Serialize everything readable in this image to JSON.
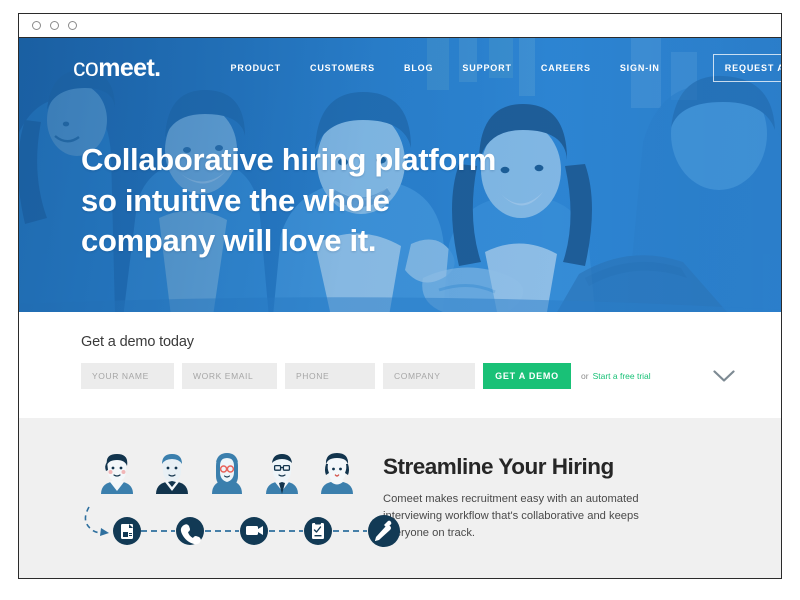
{
  "browser": {
    "dots": [
      "traffic-dot",
      "traffic-dot",
      "traffic-dot"
    ]
  },
  "hero": {
    "logo_light": "co",
    "logo_bold": "meet.",
    "nav": [
      {
        "label": "PRODUCT"
      },
      {
        "label": "CUSTOMERS"
      },
      {
        "label": "BLOG"
      },
      {
        "label": "SUPPORT"
      },
      {
        "label": "CAREERS"
      },
      {
        "label": "SIGN-IN"
      }
    ],
    "cta_label": "REQUEST A DEMO ›",
    "headline_line1": "Collaborative hiring platform",
    "headline_line2": "so intuitive the whole",
    "headline_line3": "company will love it.",
    "bg_left": "#1d66ad",
    "bg_right": "#2f85d3"
  },
  "demo_form": {
    "heading": "Get a demo today",
    "fields": [
      {
        "placeholder": "YOUR NAME",
        "value": ""
      },
      {
        "placeholder": "WORK EMAIL",
        "value": ""
      },
      {
        "placeholder": "PHONE",
        "value": ""
      },
      {
        "placeholder": "COMPANY",
        "value": ""
      }
    ],
    "submit_label": "GET A DEMO",
    "or_text": "or",
    "trial_link": "Start a free trial",
    "accent_green": "#19c177",
    "expand_icon": "chevron-down-icon"
  },
  "streamline": {
    "title": "Streamline Your Hiring",
    "body": "Comeet makes recruitment easy with an automated interviewing workflow that's collaborative and keeps everyone on track.",
    "avatars": [
      {
        "name": "avatar-person-1"
      },
      {
        "name": "avatar-person-2"
      },
      {
        "name": "avatar-person-3"
      },
      {
        "name": "avatar-person-4"
      },
      {
        "name": "avatar-person-5"
      }
    ],
    "steps": [
      {
        "icon": "resume-icon"
      },
      {
        "icon": "phone-icon"
      },
      {
        "icon": "video-interview-icon"
      },
      {
        "icon": "assessment-icon"
      },
      {
        "icon": "hired-icon"
      }
    ],
    "bg": "#f0f0f0"
  }
}
